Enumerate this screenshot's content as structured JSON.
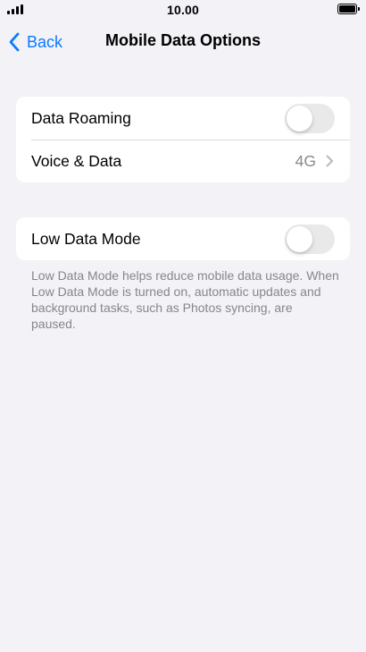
{
  "status_bar": {
    "time": "10.00"
  },
  "nav": {
    "back_label": "Back",
    "title": "Mobile Data Options"
  },
  "group_1": {
    "data_roaming_label": "Data Roaming",
    "data_roaming_on": false,
    "voice_data_label": "Voice & Data",
    "voice_data_value": "4G"
  },
  "group_2": {
    "low_data_mode_label": "Low Data Mode",
    "low_data_mode_on": false
  },
  "footer": {
    "text": "Low Data Mode helps reduce mobile data usage. When Low Data Mode is turned on, automatic updates and background tasks, such as Photos syncing, are paused."
  },
  "colors": {
    "accent": "#0a7aff",
    "background": "#f2f2f7",
    "toggle_off": "#e9e9ea",
    "secondary_text": "#8a8a8e"
  },
  "icons": {
    "back": "chevron-left-icon",
    "disclosure": "chevron-right-icon",
    "signal": "cellular-signal-icon",
    "battery": "battery-icon"
  }
}
